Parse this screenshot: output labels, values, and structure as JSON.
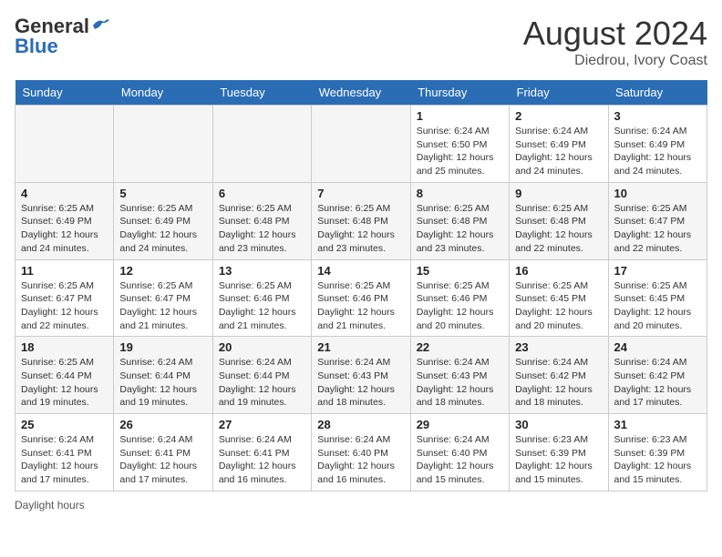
{
  "header": {
    "logo_line1": "General",
    "logo_line2": "Blue",
    "month_year": "August 2024",
    "location": "Diedrou, Ivory Coast"
  },
  "days_of_week": [
    "Sunday",
    "Monday",
    "Tuesday",
    "Wednesday",
    "Thursday",
    "Friday",
    "Saturday"
  ],
  "weeks": [
    {
      "days": [
        {
          "num": "",
          "info": ""
        },
        {
          "num": "",
          "info": ""
        },
        {
          "num": "",
          "info": ""
        },
        {
          "num": "",
          "info": ""
        },
        {
          "num": "1",
          "info": "Sunrise: 6:24 AM\nSunset: 6:50 PM\nDaylight: 12 hours\nand 25 minutes."
        },
        {
          "num": "2",
          "info": "Sunrise: 6:24 AM\nSunset: 6:49 PM\nDaylight: 12 hours\nand 24 minutes."
        },
        {
          "num": "3",
          "info": "Sunrise: 6:24 AM\nSunset: 6:49 PM\nDaylight: 12 hours\nand 24 minutes."
        }
      ]
    },
    {
      "days": [
        {
          "num": "4",
          "info": "Sunrise: 6:25 AM\nSunset: 6:49 PM\nDaylight: 12 hours\nand 24 minutes."
        },
        {
          "num": "5",
          "info": "Sunrise: 6:25 AM\nSunset: 6:49 PM\nDaylight: 12 hours\nand 24 minutes."
        },
        {
          "num": "6",
          "info": "Sunrise: 6:25 AM\nSunset: 6:48 PM\nDaylight: 12 hours\nand 23 minutes."
        },
        {
          "num": "7",
          "info": "Sunrise: 6:25 AM\nSunset: 6:48 PM\nDaylight: 12 hours\nand 23 minutes."
        },
        {
          "num": "8",
          "info": "Sunrise: 6:25 AM\nSunset: 6:48 PM\nDaylight: 12 hours\nand 23 minutes."
        },
        {
          "num": "9",
          "info": "Sunrise: 6:25 AM\nSunset: 6:48 PM\nDaylight: 12 hours\nand 22 minutes."
        },
        {
          "num": "10",
          "info": "Sunrise: 6:25 AM\nSunset: 6:47 PM\nDaylight: 12 hours\nand 22 minutes."
        }
      ]
    },
    {
      "days": [
        {
          "num": "11",
          "info": "Sunrise: 6:25 AM\nSunset: 6:47 PM\nDaylight: 12 hours\nand 22 minutes."
        },
        {
          "num": "12",
          "info": "Sunrise: 6:25 AM\nSunset: 6:47 PM\nDaylight: 12 hours\nand 21 minutes."
        },
        {
          "num": "13",
          "info": "Sunrise: 6:25 AM\nSunset: 6:46 PM\nDaylight: 12 hours\nand 21 minutes."
        },
        {
          "num": "14",
          "info": "Sunrise: 6:25 AM\nSunset: 6:46 PM\nDaylight: 12 hours\nand 21 minutes."
        },
        {
          "num": "15",
          "info": "Sunrise: 6:25 AM\nSunset: 6:46 PM\nDaylight: 12 hours\nand 20 minutes."
        },
        {
          "num": "16",
          "info": "Sunrise: 6:25 AM\nSunset: 6:45 PM\nDaylight: 12 hours\nand 20 minutes."
        },
        {
          "num": "17",
          "info": "Sunrise: 6:25 AM\nSunset: 6:45 PM\nDaylight: 12 hours\nand 20 minutes."
        }
      ]
    },
    {
      "days": [
        {
          "num": "18",
          "info": "Sunrise: 6:25 AM\nSunset: 6:44 PM\nDaylight: 12 hours\nand 19 minutes."
        },
        {
          "num": "19",
          "info": "Sunrise: 6:24 AM\nSunset: 6:44 PM\nDaylight: 12 hours\nand 19 minutes."
        },
        {
          "num": "20",
          "info": "Sunrise: 6:24 AM\nSunset: 6:44 PM\nDaylight: 12 hours\nand 19 minutes."
        },
        {
          "num": "21",
          "info": "Sunrise: 6:24 AM\nSunset: 6:43 PM\nDaylight: 12 hours\nand 18 minutes."
        },
        {
          "num": "22",
          "info": "Sunrise: 6:24 AM\nSunset: 6:43 PM\nDaylight: 12 hours\nand 18 minutes."
        },
        {
          "num": "23",
          "info": "Sunrise: 6:24 AM\nSunset: 6:42 PM\nDaylight: 12 hours\nand 18 minutes."
        },
        {
          "num": "24",
          "info": "Sunrise: 6:24 AM\nSunset: 6:42 PM\nDaylight: 12 hours\nand 17 minutes."
        }
      ]
    },
    {
      "days": [
        {
          "num": "25",
          "info": "Sunrise: 6:24 AM\nSunset: 6:41 PM\nDaylight: 12 hours\nand 17 minutes."
        },
        {
          "num": "26",
          "info": "Sunrise: 6:24 AM\nSunset: 6:41 PM\nDaylight: 12 hours\nand 17 minutes."
        },
        {
          "num": "27",
          "info": "Sunrise: 6:24 AM\nSunset: 6:41 PM\nDaylight: 12 hours\nand 16 minutes."
        },
        {
          "num": "28",
          "info": "Sunrise: 6:24 AM\nSunset: 6:40 PM\nDaylight: 12 hours\nand 16 minutes."
        },
        {
          "num": "29",
          "info": "Sunrise: 6:24 AM\nSunset: 6:40 PM\nDaylight: 12 hours\nand 15 minutes."
        },
        {
          "num": "30",
          "info": "Sunrise: 6:23 AM\nSunset: 6:39 PM\nDaylight: 12 hours\nand 15 minutes."
        },
        {
          "num": "31",
          "info": "Sunrise: 6:23 AM\nSunset: 6:39 PM\nDaylight: 12 hours\nand 15 minutes."
        }
      ]
    }
  ],
  "footer": {
    "text": "Daylight hours"
  }
}
